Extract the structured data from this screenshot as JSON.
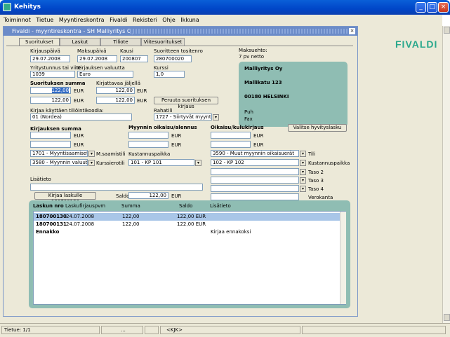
{
  "window": {
    "title": "Kehitys"
  },
  "menu": [
    "Toiminnot",
    "Tietue",
    "Myyntireskontra",
    "Fivaldi",
    "Rekisteri",
    "Ohje",
    "Ikkuna"
  ],
  "logo": "FIVALDI",
  "inner": {
    "title": "Fivaldi - myyntireskontra - SH Malliyritys Oy"
  },
  "tabs": [
    "Suoritukset",
    "Laskut",
    "Tiliote",
    "Viitesuoritukset"
  ],
  "form": {
    "kirjauspaiva_label": "Kirjauspäivä",
    "kirjauspaiva": "29.07.2008",
    "maksupaiva_label": "Maksupäivä",
    "maksupaiva": "29.07.2008",
    "kausi_label": "Kausi",
    "kausi": "200807",
    "tosite_label": "Suoritteen tositenro",
    "tosite": "280700020",
    "maksuehto_label": "Maksuehto:",
    "maksuehto": "7 pv netto",
    "ytunnus_label": "Yritystunnus tai viite",
    "ytunnus": "1039",
    "valuutta_label": "Kirjauksen valuutta",
    "valuutta": "Euro",
    "kurssi_label": "Kurssi",
    "kurssi": "1,0",
    "summa_label": "Suorituksen summa",
    "summa1": "122,00",
    "cur": "EUR",
    "summa2": "122,00",
    "jaljella_label": "Kirjattavaa jäljellä",
    "jaljella1": "122,00",
    "jaljella2": "122,00",
    "peruuta": "Peruuta suorituksen kirjaus",
    "tiliointikoodi_label": "Kirjaa käyttäen tiliöintikoodia:",
    "tiliointikoodi": "01 (Nordea)",
    "rahatili_label": "Rahatili",
    "rahatili": "1727 - Siirtyvät myyntisaamiset",
    "kirjauksen_summa": "Kirjauksen summa",
    "myynnin_oikaisu": "Myynnin oikaisu/alennus",
    "oikaisu_kulu": "Oikaisu/kulukirjaus",
    "valitse": "Valitse hyvityslasku",
    "acc1": "1701 - Myyntisaamiset 1",
    "acc1_lbl": "M.saamistili",
    "acc2": "3580 - Myynnin valuuttakurssiero",
    "acc2_lbl": "Kurssierotili",
    "kp_label": "Kustannuspaikka",
    "kp": "101 - KP 101",
    "acc3": "3590 - Muut myynnin oikaisuerät",
    "acc3_lbl": "Tili",
    "kp2": "102 - KP 102",
    "kp2_lbl": "Kustannuspaikka",
    "taso2": "Taso 2",
    "taso3": "Taso 3",
    "taso4": "Taso 4",
    "verokanta": "Verokanta",
    "lisatieto_label": "Lisätieto",
    "kirjaa_btn": "Kirjaa laskulle 180700130",
    "saldo_label": "Saldo",
    "saldo": "122,00"
  },
  "address": {
    "name": "Malliyritys Oy",
    "street": "Mallikatu 123",
    "city": "00180 HELSINKI",
    "puh": "Puh",
    "fax": "Fax"
  },
  "grid": {
    "headers": [
      "Laskun nro",
      "Laskufirjauspvm",
      "Summa",
      "Saldo",
      "Lisätieto"
    ],
    "rows": [
      {
        "nro": "180700130",
        "pvm": "24.07.2008",
        "summa": "122,00",
        "saldo": "122,00 EUR",
        "lisa": ""
      },
      {
        "nro": "180700131",
        "pvm": "24.07.2008",
        "summa": "122,00",
        "saldo": "122,00 EUR",
        "lisa": ""
      },
      {
        "nro": "Ennakko",
        "pvm": "",
        "summa": "",
        "saldo": "",
        "lisa": "Kirjaa ennakoksi"
      }
    ]
  },
  "status": {
    "tietue": "Tietue: 1/1",
    "dots": "...",
    "mode": "<KJK>"
  }
}
